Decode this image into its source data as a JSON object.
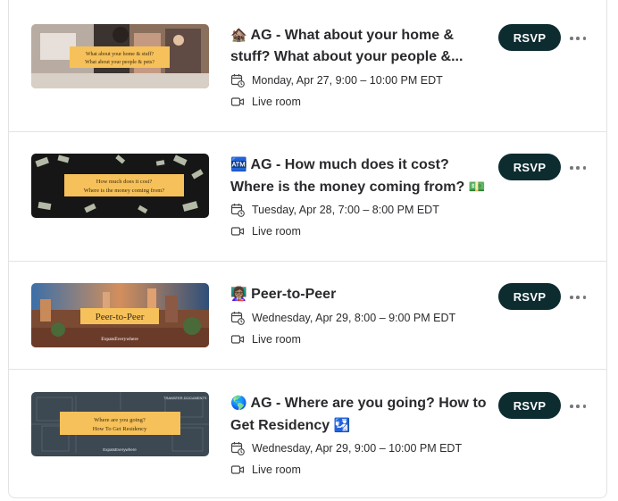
{
  "events": [
    {
      "emoji": "🏚️",
      "title": "AG - What about your home & stuff? What about your people &...",
      "date": "Monday, Apr 27, 9:00 – 10:00 PM EDT",
      "location": "Live room",
      "rsvp_label": "RSVP",
      "thumbnail_lines": [
        "What about your home & stuff?",
        "What about your people & pets?"
      ]
    },
    {
      "emoji": "🏧",
      "title": "AG - How much does it cost? Where is the money coming from?",
      "title_suffix_emoji": "💵",
      "date": "Tuesday, Apr 28, 7:00 – 8:00 PM EDT",
      "location": "Live room",
      "rsvp_label": "RSVP",
      "thumbnail_lines": [
        "How much does it cost?",
        "Where is the money coming from?"
      ]
    },
    {
      "emoji": "👩🏽‍🏫",
      "title": "Peer-to-Peer",
      "date": "Wednesday, Apr 29, 8:00 – 9:00 PM EDT",
      "location": "Live room",
      "rsvp_label": "RSVP",
      "thumbnail_lines": [
        "Peer-to-Peer",
        "ExpatsEverywhere"
      ]
    },
    {
      "emoji": "🌎",
      "title": "AG - Where are you going? How to Get Residency",
      "title_suffix_emoji": "🛂",
      "date": "Wednesday, Apr 29, 9:00 – 10:00 PM EDT",
      "location": "Live room",
      "rsvp_label": "RSVP",
      "thumbnail_lines": [
        "Where are you going?",
        "How To Get Residency",
        "TRANSFER DOCUMENTS",
        "ExpatsEverywhere"
      ]
    }
  ],
  "colors": {
    "rsvp_bg": "#0c2c30",
    "banner_yellow": "#f6c15a",
    "border": "#e3e3e6"
  },
  "icons": {
    "date": "calendar-clock-icon",
    "location": "video-camera-icon",
    "menu": "more-horizontal-icon"
  }
}
